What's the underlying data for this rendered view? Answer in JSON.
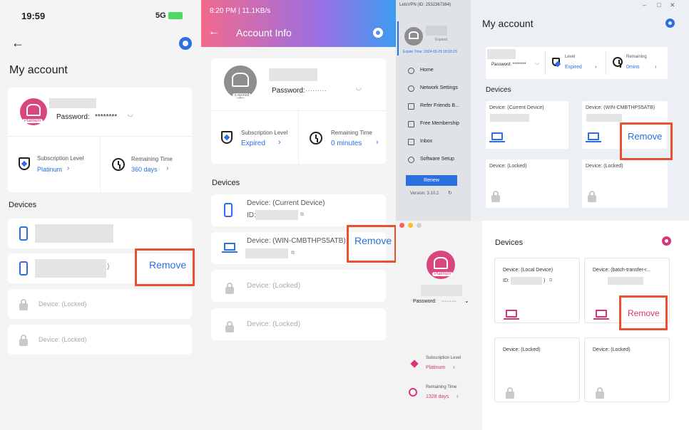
{
  "panel1": {
    "status_time": "19:59",
    "status_signal": "5G",
    "title": "My account",
    "password_label": "Password:",
    "password_mask": "********",
    "badge": "Platinum",
    "subscription_label": "Subscription Level",
    "subscription_value": "Platinum",
    "remaining_label": "Remaining Time",
    "remaining_value": "360 days",
    "devices_title": "Devices",
    "device_paren": ")",
    "remove_label": "Remove",
    "locked1": "Device: (Locked)",
    "locked2": "Device: (Locked)"
  },
  "panel2": {
    "status_time": "8:20 PM | 11.1KB/s",
    "title": "Account Info",
    "password_label": "Password:",
    "password_mask": "·········",
    "avatar_badge": "Expired",
    "subscription_label": "Subscription Level",
    "subscription_value": "Expired",
    "remaining_label": "Remaining Time",
    "remaining_value": "0 minutes",
    "devices_title": "Devices",
    "device1": "Device: (Current Device)",
    "device1_id": "ID:",
    "device2": "Device: (WIN-CMBTHPS5ATB)",
    "remove_label": "Remove",
    "locked1": "Device: (Locked)",
    "locked2": "Device: (Locked)"
  },
  "panel3": {
    "titlebar": "LetsVPN (ID: 2532367384)",
    "avatar_badge": "Expired",
    "expire": "Expire Time: 2024-03-29 18:03:23",
    "nav": [
      "Home",
      "Network Settings",
      "Refer Friends B...",
      "Free Membership",
      "Inbox",
      "Software Setup"
    ],
    "renew": "Renew",
    "version": "Version: 3.10.2",
    "title": "My account",
    "password_label": "Password: ********",
    "level_label": "Level",
    "level_value": "Expired",
    "remaining_label": "Remaining",
    "remaining_value": "0mins",
    "devices_title": "Devices",
    "device1": "Device: (Current Device)",
    "device2": "Device: (WIN-CMBTHPS5ATB)",
    "remove_label": "Remove",
    "locked1": "Device: (Locked)",
    "locked2": "Device: (Locked)"
  },
  "panel4": {
    "badge": "Platinum",
    "password_label": "Password:",
    "password_mask": "·········",
    "subscription_label": "Subscription Level",
    "subscription_value": "Platinum",
    "remaining_label": "Remaining Time",
    "remaining_value": "1328 days",
    "devices_title": "Devices",
    "device1": "Device: (Local Device)",
    "device1_id": "ID:",
    "device1_paren": ")",
    "device2": "Device: (batch-transfer-r...",
    "remove_label": "Remove",
    "locked1": "Device: (Locked)",
    "locked2": "Device: (Locked)"
  },
  "colors": {
    "blue": "#2b6fe0",
    "pink": "#d6357a",
    "red_box": "#e8502e"
  }
}
